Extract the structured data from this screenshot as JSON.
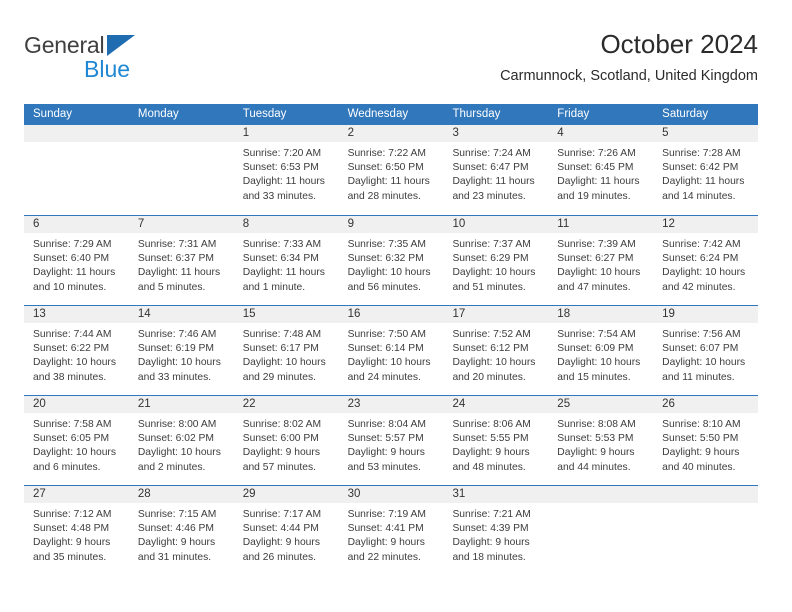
{
  "brand": {
    "name_part1": "General",
    "name_part2": "Blue",
    "triangle_icon": "blue-triangle-logo",
    "accent_dark": "#1f6cb0",
    "accent_light": "#1f87d4"
  },
  "header": {
    "title": "October 2024",
    "subtitle": "Carmunnock, Scotland, United Kingdom"
  },
  "theme": {
    "header_blue": "#3077bc",
    "band_gray": "#f0f0f0",
    "text": "#3d3d3d"
  },
  "weekdays": [
    "Sunday",
    "Monday",
    "Tuesday",
    "Wednesday",
    "Thursday",
    "Friday",
    "Saturday"
  ],
  "weeks": [
    [
      {
        "day": ""
      },
      {
        "day": ""
      },
      {
        "day": "1",
        "sunrise": "Sunrise: 7:20 AM",
        "sunset": "Sunset: 6:53 PM",
        "daylight1": "Daylight: 11 hours",
        "daylight2": "and 33 minutes."
      },
      {
        "day": "2",
        "sunrise": "Sunrise: 7:22 AM",
        "sunset": "Sunset: 6:50 PM",
        "daylight1": "Daylight: 11 hours",
        "daylight2": "and 28 minutes."
      },
      {
        "day": "3",
        "sunrise": "Sunrise: 7:24 AM",
        "sunset": "Sunset: 6:47 PM",
        "daylight1": "Daylight: 11 hours",
        "daylight2": "and 23 minutes."
      },
      {
        "day": "4",
        "sunrise": "Sunrise: 7:26 AM",
        "sunset": "Sunset: 6:45 PM",
        "daylight1": "Daylight: 11 hours",
        "daylight2": "and 19 minutes."
      },
      {
        "day": "5",
        "sunrise": "Sunrise: 7:28 AM",
        "sunset": "Sunset: 6:42 PM",
        "daylight1": "Daylight: 11 hours",
        "daylight2": "and 14 minutes."
      }
    ],
    [
      {
        "day": "6",
        "sunrise": "Sunrise: 7:29 AM",
        "sunset": "Sunset: 6:40 PM",
        "daylight1": "Daylight: 11 hours",
        "daylight2": "and 10 minutes."
      },
      {
        "day": "7",
        "sunrise": "Sunrise: 7:31 AM",
        "sunset": "Sunset: 6:37 PM",
        "daylight1": "Daylight: 11 hours",
        "daylight2": "and 5 minutes."
      },
      {
        "day": "8",
        "sunrise": "Sunrise: 7:33 AM",
        "sunset": "Sunset: 6:34 PM",
        "daylight1": "Daylight: 11 hours",
        "daylight2": "and 1 minute."
      },
      {
        "day": "9",
        "sunrise": "Sunrise: 7:35 AM",
        "sunset": "Sunset: 6:32 PM",
        "daylight1": "Daylight: 10 hours",
        "daylight2": "and 56 minutes."
      },
      {
        "day": "10",
        "sunrise": "Sunrise: 7:37 AM",
        "sunset": "Sunset: 6:29 PM",
        "daylight1": "Daylight: 10 hours",
        "daylight2": "and 51 minutes."
      },
      {
        "day": "11",
        "sunrise": "Sunrise: 7:39 AM",
        "sunset": "Sunset: 6:27 PM",
        "daylight1": "Daylight: 10 hours",
        "daylight2": "and 47 minutes."
      },
      {
        "day": "12",
        "sunrise": "Sunrise: 7:42 AM",
        "sunset": "Sunset: 6:24 PM",
        "daylight1": "Daylight: 10 hours",
        "daylight2": "and 42 minutes."
      }
    ],
    [
      {
        "day": "13",
        "sunrise": "Sunrise: 7:44 AM",
        "sunset": "Sunset: 6:22 PM",
        "daylight1": "Daylight: 10 hours",
        "daylight2": "and 38 minutes."
      },
      {
        "day": "14",
        "sunrise": "Sunrise: 7:46 AM",
        "sunset": "Sunset: 6:19 PM",
        "daylight1": "Daylight: 10 hours",
        "daylight2": "and 33 minutes."
      },
      {
        "day": "15",
        "sunrise": "Sunrise: 7:48 AM",
        "sunset": "Sunset: 6:17 PM",
        "daylight1": "Daylight: 10 hours",
        "daylight2": "and 29 minutes."
      },
      {
        "day": "16",
        "sunrise": "Sunrise: 7:50 AM",
        "sunset": "Sunset: 6:14 PM",
        "daylight1": "Daylight: 10 hours",
        "daylight2": "and 24 minutes."
      },
      {
        "day": "17",
        "sunrise": "Sunrise: 7:52 AM",
        "sunset": "Sunset: 6:12 PM",
        "daylight1": "Daylight: 10 hours",
        "daylight2": "and 20 minutes."
      },
      {
        "day": "18",
        "sunrise": "Sunrise: 7:54 AM",
        "sunset": "Sunset: 6:09 PM",
        "daylight1": "Daylight: 10 hours",
        "daylight2": "and 15 minutes."
      },
      {
        "day": "19",
        "sunrise": "Sunrise: 7:56 AM",
        "sunset": "Sunset: 6:07 PM",
        "daylight1": "Daylight: 10 hours",
        "daylight2": "and 11 minutes."
      }
    ],
    [
      {
        "day": "20",
        "sunrise": "Sunrise: 7:58 AM",
        "sunset": "Sunset: 6:05 PM",
        "daylight1": "Daylight: 10 hours",
        "daylight2": "and 6 minutes."
      },
      {
        "day": "21",
        "sunrise": "Sunrise: 8:00 AM",
        "sunset": "Sunset: 6:02 PM",
        "daylight1": "Daylight: 10 hours",
        "daylight2": "and 2 minutes."
      },
      {
        "day": "22",
        "sunrise": "Sunrise: 8:02 AM",
        "sunset": "Sunset: 6:00 PM",
        "daylight1": "Daylight: 9 hours",
        "daylight2": "and 57 minutes."
      },
      {
        "day": "23",
        "sunrise": "Sunrise: 8:04 AM",
        "sunset": "Sunset: 5:57 PM",
        "daylight1": "Daylight: 9 hours",
        "daylight2": "and 53 minutes."
      },
      {
        "day": "24",
        "sunrise": "Sunrise: 8:06 AM",
        "sunset": "Sunset: 5:55 PM",
        "daylight1": "Daylight: 9 hours",
        "daylight2": "and 48 minutes."
      },
      {
        "day": "25",
        "sunrise": "Sunrise: 8:08 AM",
        "sunset": "Sunset: 5:53 PM",
        "daylight1": "Daylight: 9 hours",
        "daylight2": "and 44 minutes."
      },
      {
        "day": "26",
        "sunrise": "Sunrise: 8:10 AM",
        "sunset": "Sunset: 5:50 PM",
        "daylight1": "Daylight: 9 hours",
        "daylight2": "and 40 minutes."
      }
    ],
    [
      {
        "day": "27",
        "sunrise": "Sunrise: 7:12 AM",
        "sunset": "Sunset: 4:48 PM",
        "daylight1": "Daylight: 9 hours",
        "daylight2": "and 35 minutes."
      },
      {
        "day": "28",
        "sunrise": "Sunrise: 7:15 AM",
        "sunset": "Sunset: 4:46 PM",
        "daylight1": "Daylight: 9 hours",
        "daylight2": "and 31 minutes."
      },
      {
        "day": "29",
        "sunrise": "Sunrise: 7:17 AM",
        "sunset": "Sunset: 4:44 PM",
        "daylight1": "Daylight: 9 hours",
        "daylight2": "and 26 minutes."
      },
      {
        "day": "30",
        "sunrise": "Sunrise: 7:19 AM",
        "sunset": "Sunset: 4:41 PM",
        "daylight1": "Daylight: 9 hours",
        "daylight2": "and 22 minutes."
      },
      {
        "day": "31",
        "sunrise": "Sunrise: 7:21 AM",
        "sunset": "Sunset: 4:39 PM",
        "daylight1": "Daylight: 9 hours",
        "daylight2": "and 18 minutes."
      },
      {
        "day": ""
      },
      {
        "day": ""
      }
    ]
  ]
}
